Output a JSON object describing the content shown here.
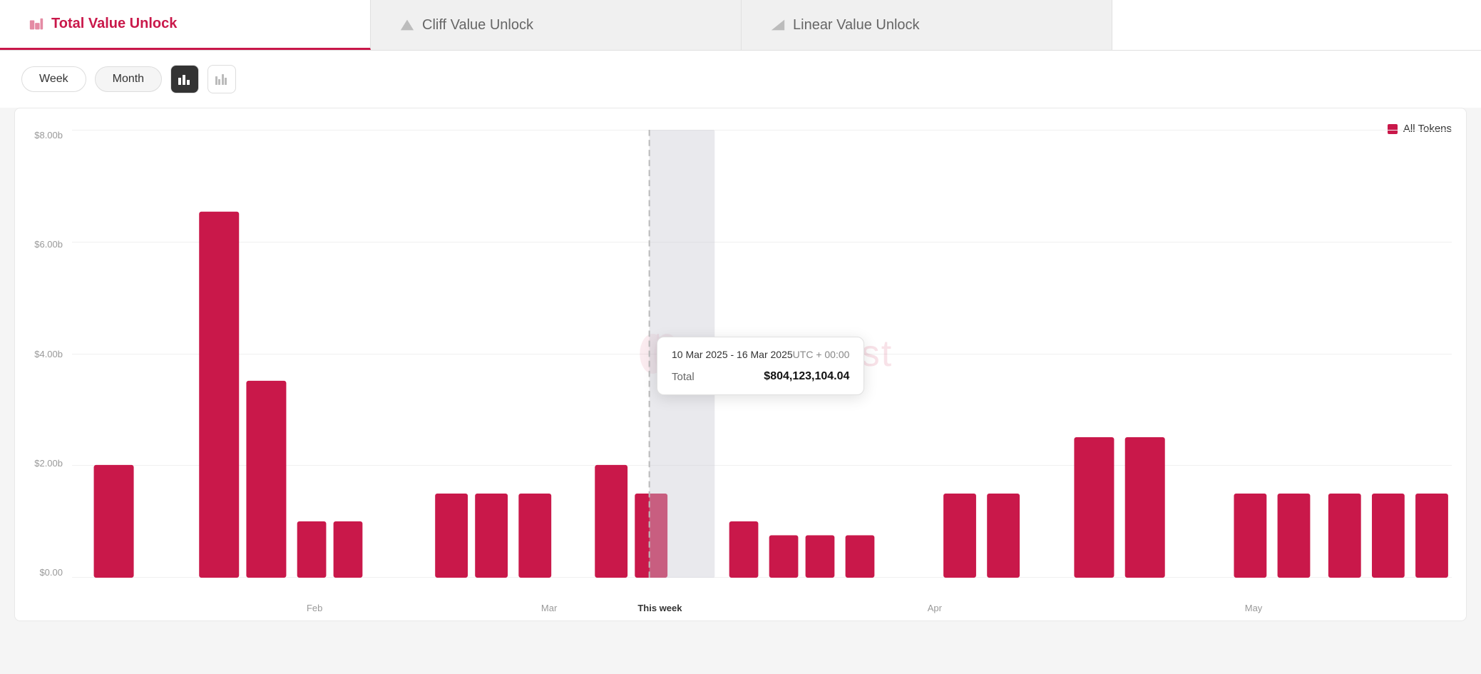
{
  "tabs": [
    {
      "id": "total",
      "label": "Total Value Unlock",
      "active": true
    },
    {
      "id": "cliff",
      "label": "Cliff Value Unlock",
      "active": false
    },
    {
      "id": "linear",
      "label": "Linear Value Unlock",
      "active": false
    }
  ],
  "controls": {
    "period_buttons": [
      {
        "id": "week",
        "label": "Week",
        "active": false
      },
      {
        "id": "month",
        "label": "Month",
        "active": true
      }
    ],
    "chart_types": [
      {
        "id": "bar",
        "icon": "▐▐",
        "active": true
      },
      {
        "id": "grouped",
        "icon": "▐▐▐",
        "active": false
      }
    ]
  },
  "chart": {
    "legend": "All Tokens",
    "watermark": "tokenomist",
    "y_labels": [
      "$0.00",
      "$2.00b",
      "$4.00b",
      "$6.00b",
      "$8.00b"
    ],
    "x_labels": [
      "Feb",
      "Mar",
      "This week",
      "Apr",
      "May"
    ],
    "tooltip": {
      "date_range": "10 Mar 2025 - 16 Mar 2025",
      "timezone": "UTC + 00:00",
      "total_label": "Total",
      "total_value": "$804,123,104.04"
    }
  }
}
